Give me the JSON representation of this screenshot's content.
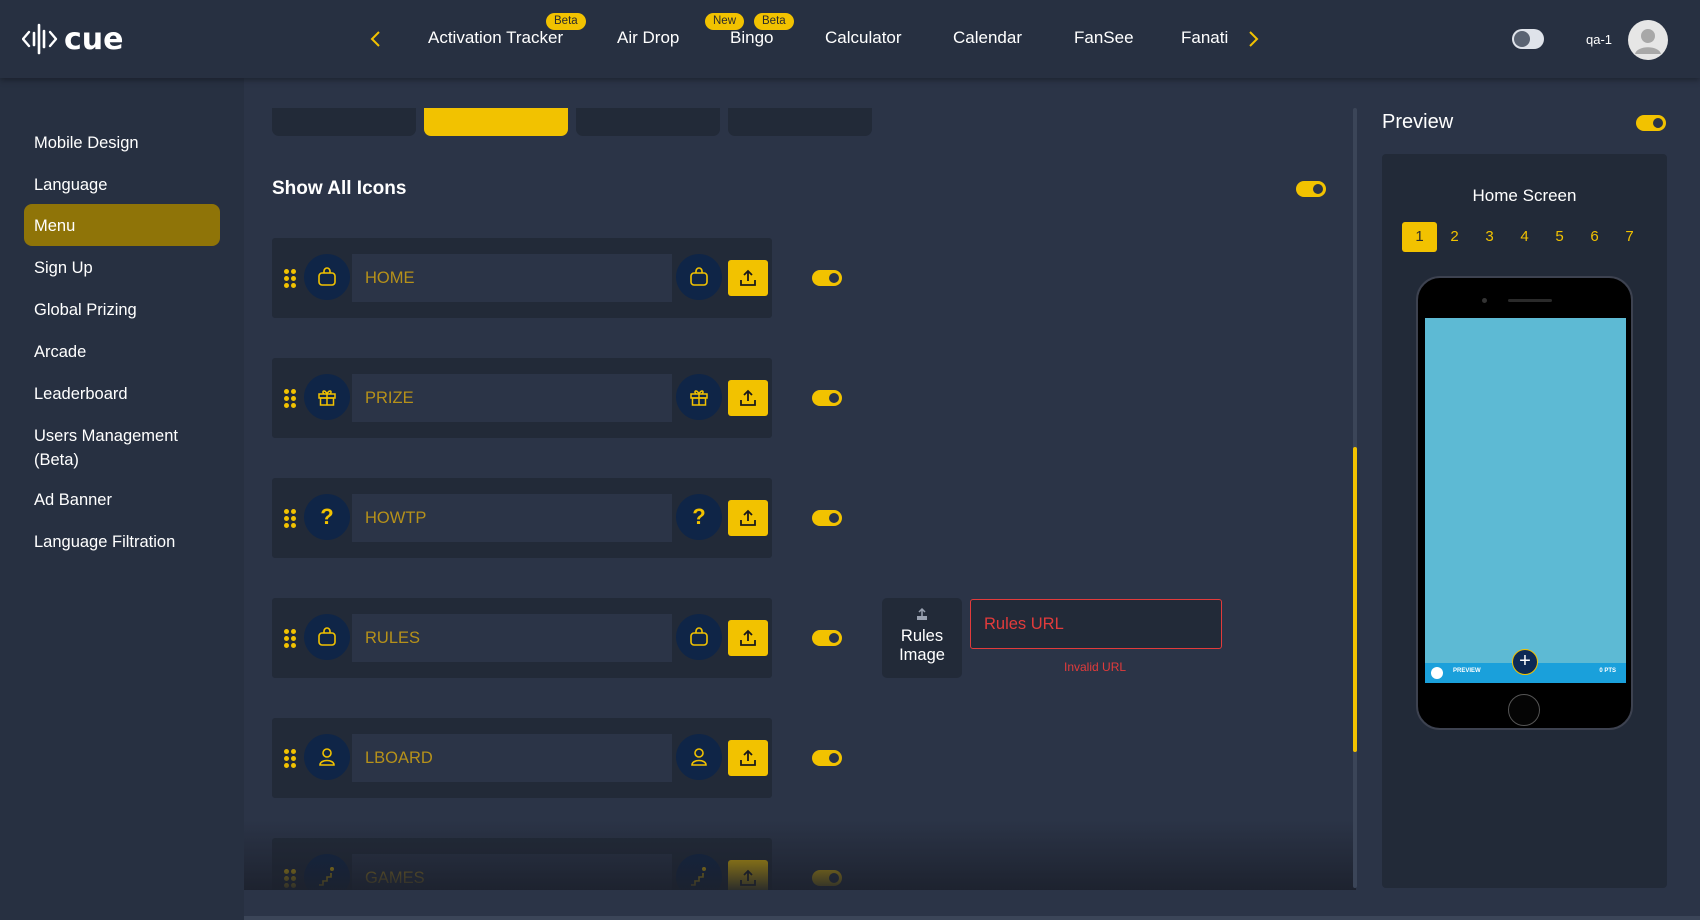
{
  "app": {
    "logo_text": "cue",
    "accent_color": "#f2c200",
    "error_color": "#e23b3b"
  },
  "topnav": {
    "prev_icon": "chevron-left-icon",
    "next_icon": "chevron-right-icon",
    "tabs": [
      {
        "label": "Activation Tracker",
        "badges": [
          "Beta"
        ]
      },
      {
        "label": "Air Drop",
        "badges": []
      },
      {
        "label": "Bingo",
        "badges": [
          "New",
          "Beta"
        ]
      },
      {
        "label": "Calculator",
        "badges": []
      },
      {
        "label": "Calendar",
        "badges": []
      },
      {
        "label": "FanSee",
        "badges": []
      },
      {
        "label": "Fanati",
        "badges": []
      }
    ],
    "user_name": "qa-1"
  },
  "sidebar": {
    "items": [
      {
        "label": "Mobile Design",
        "active": false
      },
      {
        "label": "Language",
        "active": false
      },
      {
        "label": "Menu",
        "active": true
      },
      {
        "label": "Sign Up",
        "active": false
      },
      {
        "label": "Global Prizing",
        "active": false
      },
      {
        "label": "Arcade",
        "active": false
      },
      {
        "label": "Leaderboard",
        "active": false
      },
      {
        "label": "Users Management (Beta)",
        "active": false
      },
      {
        "label": "Ad Banner",
        "active": false
      },
      {
        "label": "Language Filtration",
        "active": false
      }
    ]
  },
  "editor": {
    "active_top_tab": 2,
    "show_all_icons_label": "Show All Icons",
    "show_all_icons_on": true,
    "menu_rows": [
      {
        "label": "HOME",
        "icon": "bag-icon",
        "enabled": true
      },
      {
        "label": "PRIZE",
        "icon": "gift-icon",
        "enabled": true
      },
      {
        "label": "HOWTP",
        "icon": "question-icon",
        "enabled": true
      },
      {
        "label": "RULES",
        "icon": "bag-icon",
        "enabled": true
      },
      {
        "label": "LBOARD",
        "icon": "user-icon",
        "enabled": true
      },
      {
        "label": "GAMES",
        "icon": "climb-icon",
        "enabled": true
      }
    ],
    "rules_image_label": "Rules Image",
    "rules_url_placeholder": "Rules URL",
    "rules_url_error": "Invalid URL"
  },
  "preview": {
    "title": "Preview",
    "enabled": true,
    "screen_label": "Home Screen",
    "pages": [
      "1",
      "2",
      "3",
      "4",
      "5",
      "6",
      "7"
    ],
    "active_page": "1",
    "phone_bar_left": "PREVIEW",
    "phone_bar_right": "0 PTS",
    "screen_color": "#5dbad4",
    "bar_color": "#1aa0db"
  }
}
